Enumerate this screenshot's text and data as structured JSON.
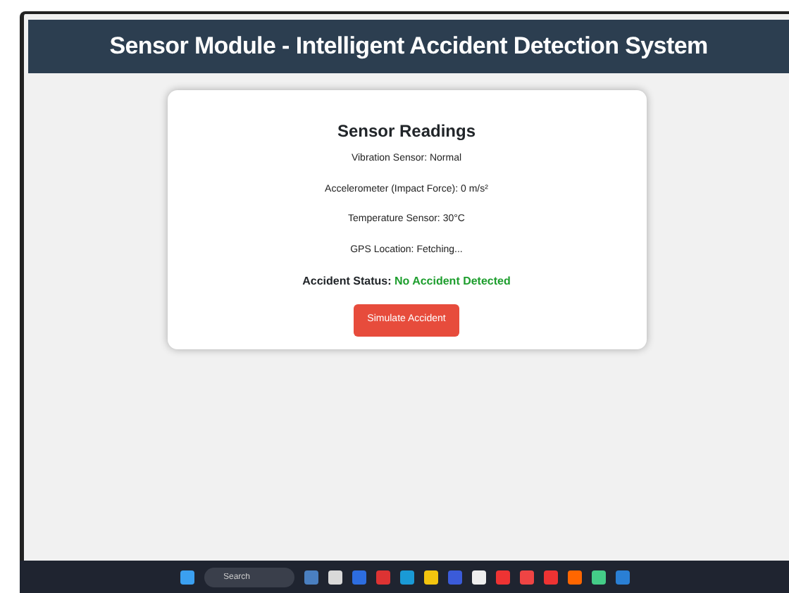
{
  "header": {
    "title": "Sensor Module - Intelligent Accident Detection System"
  },
  "card": {
    "title": "Sensor Readings",
    "readings": [
      "Vibration Sensor: Normal",
      "Accelerometer (Impact Force): 0 m/s²",
      "Temperature Sensor: 30°C",
      "GPS Location: Fetching..."
    ],
    "status": {
      "label": "Accident Status:",
      "value": "No Accident Detected",
      "kind": "safe"
    },
    "button": "Simulate Accident"
  },
  "taskbar": {
    "search": {
      "placeholder": "Search"
    }
  }
}
